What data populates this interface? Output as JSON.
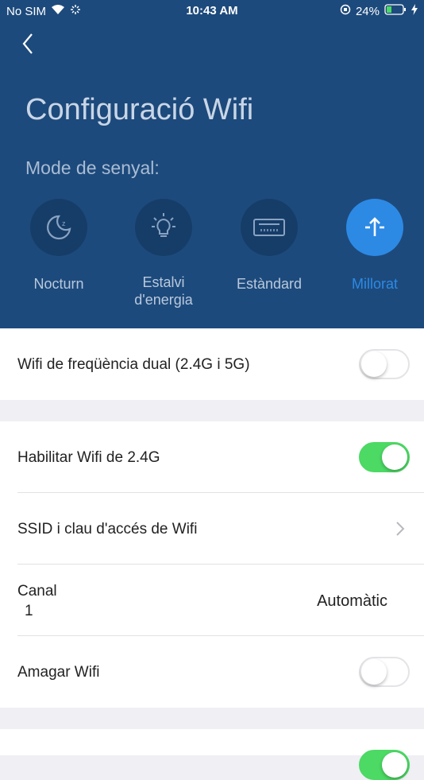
{
  "status_bar": {
    "carrier": "No SIM",
    "time": "10:43 AM",
    "battery": "24%"
  },
  "header": {
    "title": "Configuració Wifi",
    "mode_label": "Mode de senyal:",
    "modes": [
      {
        "label": "Nocturn",
        "icon": "moon-icon",
        "active": false
      },
      {
        "label_line1": "Estalvi",
        "label_line2": "d'energia",
        "icon": "lightbulb-icon",
        "active": false
      },
      {
        "label": "Estàndard",
        "icon": "router-icon",
        "active": false
      },
      {
        "label": "Millorat",
        "icon": "signal-boost-icon",
        "active": true
      }
    ]
  },
  "settings": {
    "dual_band": {
      "label": "Wifi de freqüència dual (2.4G i 5G)",
      "on": false
    },
    "enable_24g": {
      "label": "Habilitar Wifi de 2.4G",
      "on": true
    },
    "ssid": {
      "label": "SSID i clau d'accés de Wifi"
    },
    "channel": {
      "label": "Canal",
      "current": "1",
      "value": "Automàtic"
    },
    "hide_wifi": {
      "label": "Amagar Wifi",
      "on": false
    }
  },
  "colors": {
    "header_bg": "#1d4a7c",
    "accent": "#2c8ae5",
    "toggle_on": "#4cd964"
  }
}
